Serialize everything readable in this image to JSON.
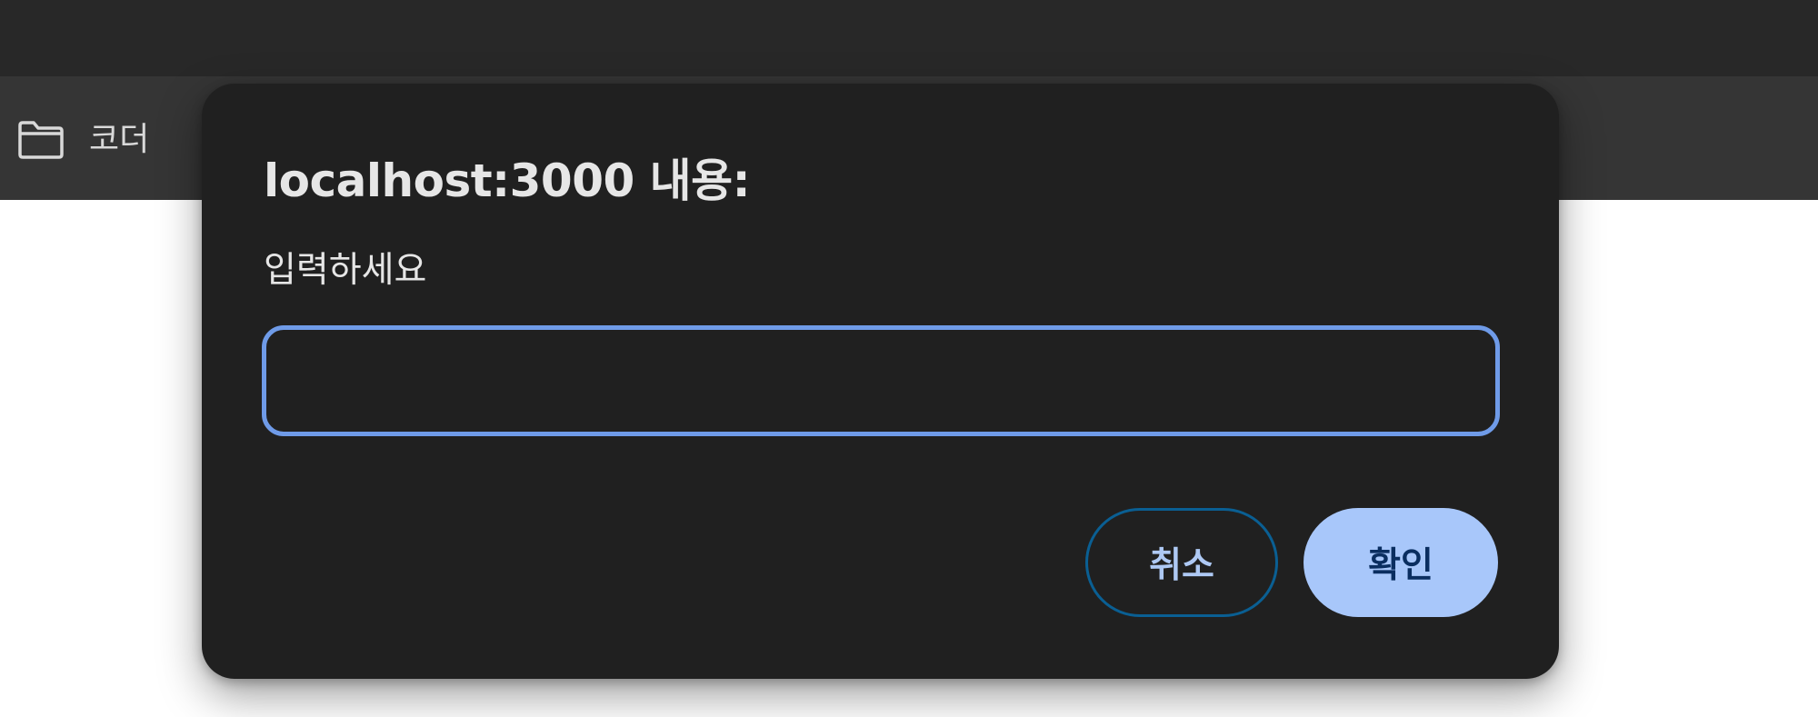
{
  "bookmarks_bar": {
    "items": [
      {
        "label": "코더",
        "icon": "folder-icon"
      }
    ]
  },
  "dialog": {
    "title": "localhost:3000 내용:",
    "message": "입력하세요",
    "input": {
      "value": "",
      "placeholder": ""
    },
    "cancel_label": "취소",
    "ok_label": "확인"
  },
  "colors": {
    "browser_top": "#282828",
    "bookmarks_bar": "#353535",
    "dialog_bg": "#202020",
    "input_focus_border": "#6f9be8",
    "cancel_border": "#0a5f93",
    "ok_bg": "#a8c7fa",
    "ok_text": "#0a2e60"
  }
}
